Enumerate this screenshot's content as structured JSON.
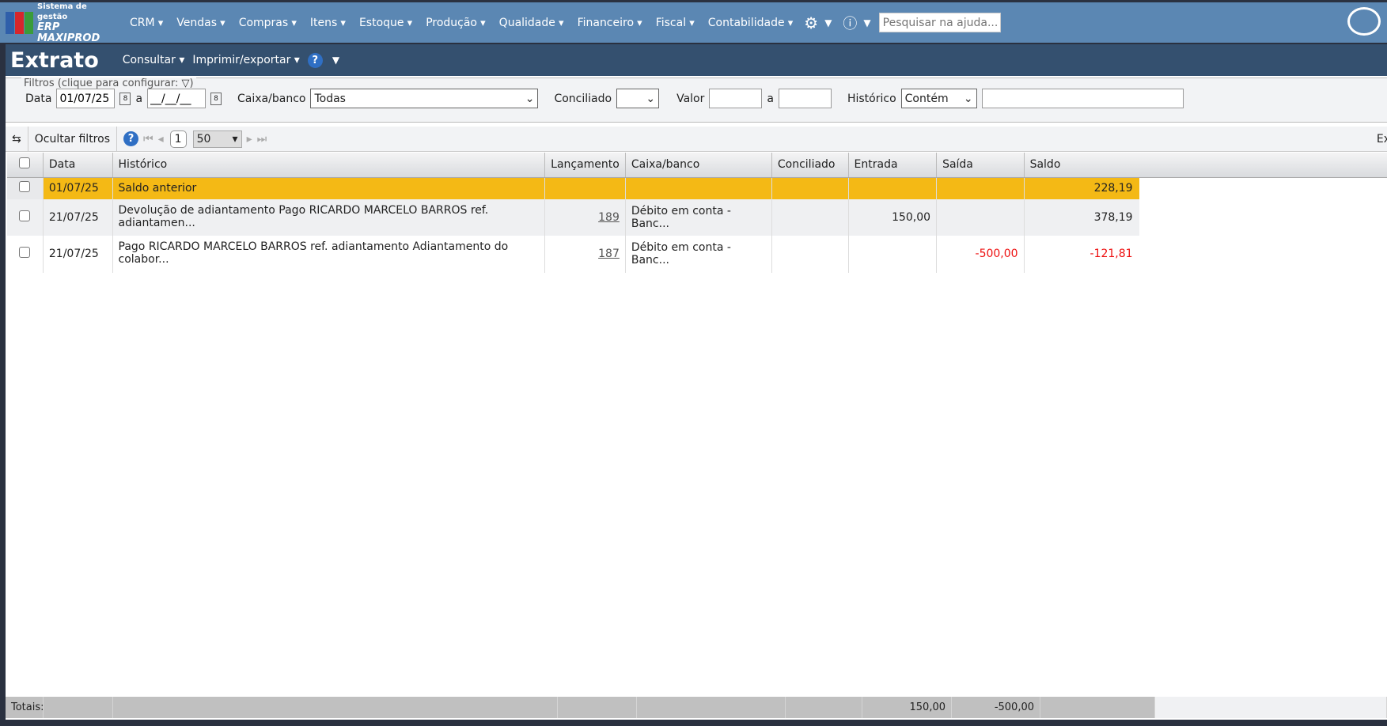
{
  "topbar": {
    "logo_line1": "Sistema de gestão",
    "logo_line2": "ERP MAXIPROD",
    "menu": [
      "CRM",
      "Vendas",
      "Compras",
      "Itens",
      "Estoque",
      "Produção",
      "Qualidade",
      "Financeiro",
      "Fiscal",
      "Contabilidade"
    ],
    "search_placeholder": "Pesquisar na ajuda..."
  },
  "header": {
    "title": "Extrato",
    "consultar": "Consultar",
    "imprimir": "Imprimir/exportar",
    "help": "?"
  },
  "filters": {
    "legend": "Filtros (clique para configurar:",
    "legend_end": ")",
    "data_label": "Data",
    "data_from": "01/07/25",
    "a": "a",
    "data_to": "__/__/__",
    "caixa_label": "Caixa/banco",
    "caixa_value": "Todas",
    "conciliado_label": "Conciliado",
    "conciliado_value": "",
    "valor_label": "Valor",
    "valor_a": "a",
    "historico_label": "Histórico",
    "historico_mode": "Contém",
    "historico_value": ""
  },
  "toolbar": {
    "hide_filters": "Ocultar filtros",
    "page": "1",
    "per_page": "50",
    "export": "Ex"
  },
  "table": {
    "headers": [
      "Data",
      "Histórico",
      "Lançamento",
      "Caixa/banco",
      "Conciliado",
      "Entrada",
      "Saída",
      "Saldo"
    ],
    "rows": [
      {
        "data": "01/07/25",
        "historico": "Saldo anterior",
        "lancamento": "",
        "caixa": "",
        "conciliado": "",
        "entrada": "",
        "saida": "",
        "saldo": "228,19"
      },
      {
        "data": "21/07/25",
        "historico": "Devolução de adiantamento Pago RICARDO MARCELO BARROS ref. adiantamen...",
        "lancamento": "189",
        "caixa": "Débito em conta - Banc...",
        "conciliado": "",
        "entrada": "150,00",
        "saida": "",
        "saldo": "378,19"
      },
      {
        "data": "21/07/25",
        "historico": "Pago RICARDO MARCELO BARROS ref. adiantamento Adiantamento do colabor...",
        "lancamento": "187",
        "caixa": "Débito em conta - Banc...",
        "conciliado": "",
        "entrada": "",
        "saida": "-500,00",
        "saldo": "-121,81"
      }
    ],
    "totals": {
      "label": "Totais:",
      "entrada": "150,00",
      "saida": "-500,00"
    }
  }
}
